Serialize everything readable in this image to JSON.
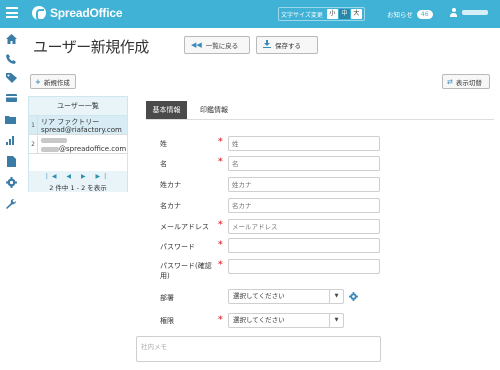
{
  "app": {
    "logo_text": "SpreadOffice"
  },
  "topbar": {
    "font_size_label": "文字サイズ変更",
    "font_sizes": [
      "小",
      "中",
      "大"
    ],
    "font_size_selected": "中",
    "notice_label": "お知らせ",
    "notice_count": "46"
  },
  "sidenav": {
    "icons": [
      "home-icon",
      "phone-icon",
      "tag-icon",
      "card-icon",
      "folder-icon",
      "chart-icon",
      "document-icon",
      "gear-icon",
      "wrench-icon"
    ]
  },
  "page": {
    "title": "ユーザー新規作成",
    "back_label": "一覧に戻る",
    "save_label": "保存する",
    "new_label": "新規作成",
    "toggle_view_label": "表示切替"
  },
  "user_list": {
    "header": "ユーザー一覧",
    "rows": [
      {
        "num": "1",
        "name": "リア ファクトリー",
        "email": "spread@riafactory.com"
      },
      {
        "num": "2",
        "name": "",
        "email_suffix": "@spreadoffice.com"
      }
    ],
    "pager_nav": "|◀ ◀ ▶ ▶|",
    "pager_text": "2 件中 1 - 2 を表示"
  },
  "tabs": {
    "basic": "基本情報",
    "print": "印鑑情報"
  },
  "form": {
    "last_name": {
      "label": "姓",
      "placeholder": "姓"
    },
    "first_name": {
      "label": "名",
      "placeholder": "名"
    },
    "last_name_kana": {
      "label": "姓カナ",
      "placeholder": "姓カナ"
    },
    "first_name_kana": {
      "label": "名カナ",
      "placeholder": "名カナ"
    },
    "email": {
      "label": "メールアドレス",
      "placeholder": "メールアドレス"
    },
    "password": {
      "label": "パスワード"
    },
    "password_confirm": {
      "label": "パスワード(確認用)"
    },
    "department": {
      "label": "部署",
      "value": "選択してください"
    },
    "role": {
      "label": "権限",
      "value": "選択してください"
    },
    "memo": {
      "placeholder": "社内メモ"
    },
    "required_mark": "*"
  },
  "colors": {
    "accent": "#3fb2d6",
    "required": "#e03c3c",
    "tab_active": "#4a4a4a"
  }
}
